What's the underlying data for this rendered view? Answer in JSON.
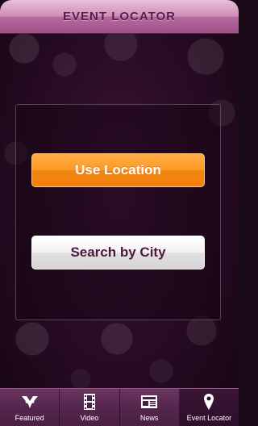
{
  "header": {
    "title": "EVENT LOCATOR"
  },
  "main": {
    "use_location_label": "Use Location",
    "search_city_label": "Search by City"
  },
  "tabbar": {
    "tabs": [
      {
        "label": "Featured",
        "icon": "featured-icon"
      },
      {
        "label": "Video",
        "icon": "film-icon"
      },
      {
        "label": "News",
        "icon": "newspaper-icon"
      },
      {
        "label": "Event Locator",
        "icon": "location-pin-icon",
        "active": true
      }
    ]
  },
  "colors": {
    "accent": "#f57f0a",
    "header": "#cf8fb8",
    "title_text": "#5a1d4b",
    "tabbar": "#55264d"
  }
}
